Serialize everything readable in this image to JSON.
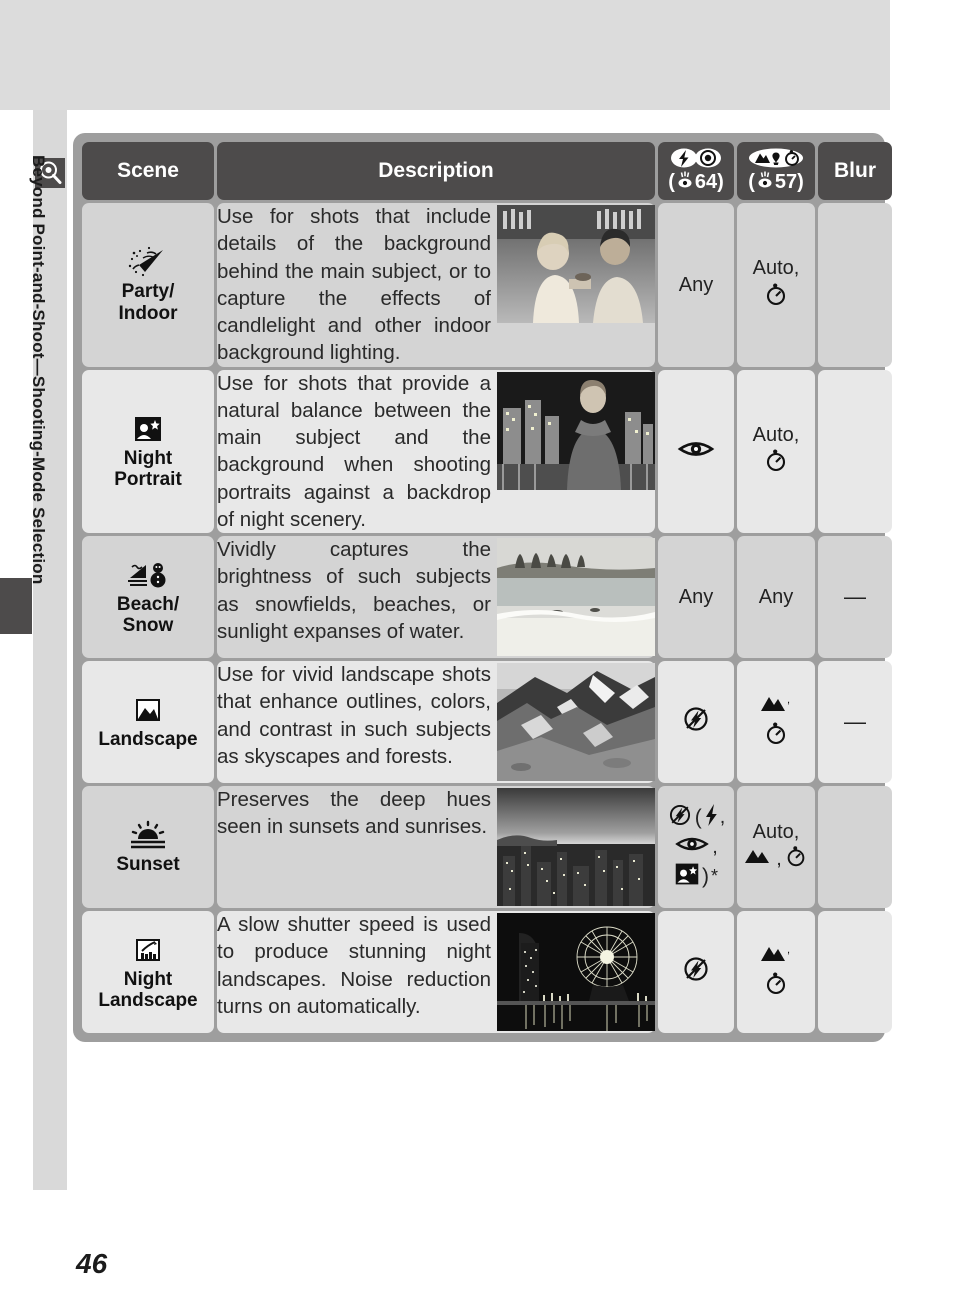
{
  "sidebar": {
    "label": "Beyond Point-and-Shoot—Shooting-Mode Selection",
    "icon": "magnifier-icon"
  },
  "page_number": "46",
  "table": {
    "headers": {
      "scene": "Scene",
      "description": "Description",
      "flash": {
        "icons": "flash-redeye-icon",
        "ref_open": "(",
        "ref_page": "64",
        "ref_close": ")"
      },
      "focus": {
        "icons": "landscape-macro-selftimer-icon",
        "ref_open": "(",
        "ref_page": "57",
        "ref_close": ")"
      },
      "blur": "Blur"
    },
    "rows": [
      {
        "scene_icon": "party-popper-icon",
        "scene": "Party/\nIndoor",
        "scene_line1": "Party/",
        "scene_line2": "Indoor",
        "description": "Use for shots that include details of the background behind the main subject, or to capture the effects of candlelight and other indoor background lighting.",
        "thumbnail": "two-people-at-bar-photo",
        "flash": "Any",
        "flash_icons": [],
        "focus": "Auto,",
        "focus_icons": [
          "self-timer-icon"
        ],
        "blur": ""
      },
      {
        "scene_icon": "night-portrait-icon",
        "scene_line1": "Night",
        "scene_line2": "Portrait",
        "description": "Use for shots that provide a natural balance between the main subject and the background when shooting portraits against a backdrop of night scenery.",
        "thumbnail": "woman-against-city-night-photo",
        "flash": "",
        "flash_icons": [
          "red-eye-reduction-icon"
        ],
        "focus": "Auto,",
        "focus_icons": [
          "self-timer-icon"
        ],
        "blur": ""
      },
      {
        "scene_icon": "beach-snow-icon",
        "scene_line1": "Beach/",
        "scene_line2": "Snow",
        "description": "Vividly captures the brightness of such subjects as snowfields, beaches, or sunlight expanses of water.",
        "thumbnail": "tropical-beach-photo",
        "flash": "Any",
        "flash_icons": [],
        "focus": "Any",
        "focus_icons": [],
        "blur": "—"
      },
      {
        "scene_icon": "landscape-icon",
        "scene_line1": "Landscape",
        "scene_line2": "",
        "description": "Use for vivid landscape shots that enhance outlines, colors, and contrast in such subjects as skyscapes and forests.",
        "thumbnail": "snowy-mountain-ridge-photo",
        "flash": "",
        "flash_icons": [
          "flash-off-icon"
        ],
        "focus": "",
        "focus_icons": [
          "infinity-landscape-icon",
          "self-timer-icon"
        ],
        "blur": "—"
      },
      {
        "scene_icon": "sunset-icon",
        "scene_line1": "Sunset",
        "scene_line2": "",
        "description": "Preserves the deep hues seen in sunsets and sunrises.",
        "thumbnail": "city-skyline-at-dusk-photo",
        "flash": "",
        "flash_icons": [
          "flash-off-icon",
          "paren-open",
          "fill-flash-icon",
          "red-eye-reduction-icon",
          "night-portrait-icon",
          "paren-close",
          "asterisk"
        ],
        "focus": "Auto,",
        "focus_icons": [
          "infinity-landscape-icon",
          "self-timer-icon"
        ],
        "blur": ""
      },
      {
        "scene_icon": "night-landscape-icon",
        "scene_line1": "Night",
        "scene_line2": "Landscape",
        "description": "A slow shutter speed is used to produce stunning night landscapes. Noise reduction turns on automatically.",
        "thumbnail": "ferris-wheel-night-harbor-photo",
        "flash": "",
        "flash_icons": [
          "flash-off-icon"
        ],
        "focus": "",
        "focus_icons": [
          "infinity-landscape-icon",
          "self-timer-icon"
        ],
        "blur": ""
      }
    ]
  },
  "colors": {
    "header_bg": "#4d4b4b",
    "table_border": "#9e9e9e",
    "row_light": "#e8e8e8",
    "row_dark": "#d4d4d4",
    "top_band": "#dcdcdc"
  }
}
